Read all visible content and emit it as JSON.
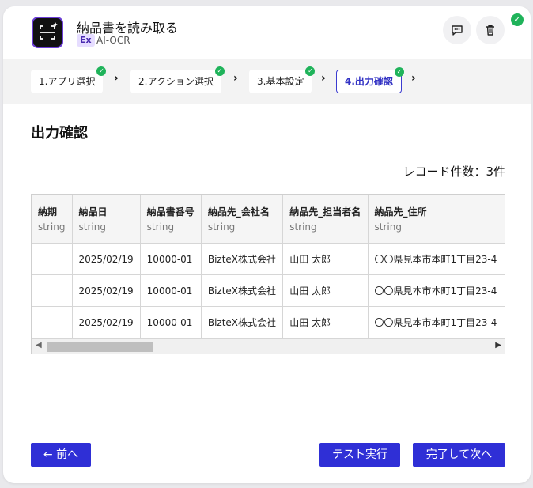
{
  "header": {
    "title": "納品書を読み取る",
    "badge": "Ex",
    "subtitle": "AI-OCR",
    "comment_icon": "comment-icon",
    "delete_icon": "trash-icon"
  },
  "steps": [
    {
      "label": "1.アプリ選択",
      "done": true
    },
    {
      "label": "2.アクション選択",
      "done": true
    },
    {
      "label": "3.基本設定",
      "done": true
    },
    {
      "label": "4.出力確認",
      "done": true,
      "active": true
    }
  ],
  "section_title": "出力確認",
  "record_count": "レコード件数：3件",
  "table": {
    "columns": [
      {
        "name": "納期",
        "type": "string"
      },
      {
        "name": "納品日",
        "type": "string"
      },
      {
        "name": "納品書番号",
        "type": "string"
      },
      {
        "name": "納品先_会社名",
        "type": "string"
      },
      {
        "name": "納品先_担当者名",
        "type": "string"
      },
      {
        "name": "納品先_住所",
        "type": "string"
      }
    ],
    "rows": [
      [
        "",
        "2025/02/19",
        "10000-01",
        "BizteX株式会社",
        "山田 太郎",
        "〇〇県見本市本町1丁目23-4"
      ],
      [
        "",
        "2025/02/19",
        "10000-01",
        "BizteX株式会社",
        "山田 太郎",
        "〇〇県見本市本町1丁目23-4"
      ],
      [
        "",
        "2025/02/19",
        "10000-01",
        "BizteX株式会社",
        "山田 太郎",
        "〇〇県見本市本町1丁目23-4"
      ]
    ]
  },
  "buttons": {
    "back": "← 前へ",
    "test": "テスト実行",
    "finish": "完了して次へ"
  },
  "colors": {
    "accent": "#2f2fd6",
    "success": "#1fb35a",
    "badge_bg": "#e6ddff"
  }
}
